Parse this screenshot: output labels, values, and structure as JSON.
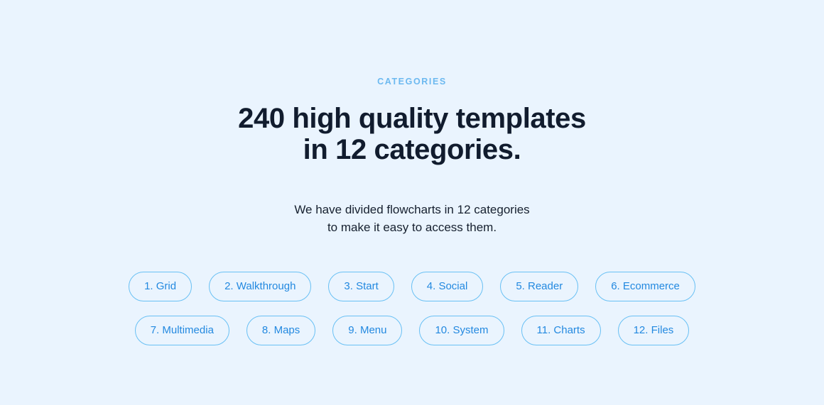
{
  "theme": {
    "background": "#eaf4fe",
    "eyebrow_color": "#6cb9f0",
    "heading_color": "#111c2e",
    "body_color": "#16202f",
    "pill_border": "#69c0f4",
    "pill_text": "#2389e0"
  },
  "section": {
    "eyebrow": "CATEGORIES",
    "heading_line1": "240 high quality templates",
    "heading_line2": "in 12 categories.",
    "subhead_line1": "We have divided flowcharts in 12 categories",
    "subhead_line2": "to make it easy to access them."
  },
  "categories": {
    "row1": [
      {
        "label": "1. Grid"
      },
      {
        "label": "2. Walkthrough"
      },
      {
        "label": "3. Start"
      },
      {
        "label": "4. Social"
      },
      {
        "label": "5. Reader"
      },
      {
        "label": "6. Ecommerce"
      }
    ],
    "row2": [
      {
        "label": "7. Multimedia"
      },
      {
        "label": "8. Maps"
      },
      {
        "label": "9. Menu"
      },
      {
        "label": "10. System"
      },
      {
        "label": "11. Charts"
      },
      {
        "label": "12. Files"
      }
    ]
  }
}
